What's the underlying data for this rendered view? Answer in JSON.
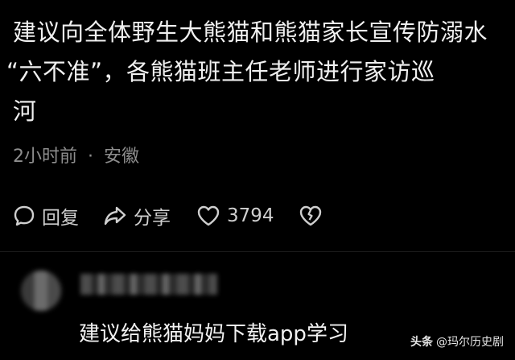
{
  "comment": {
    "lines": [
      "建议向全体野生大熊猫和熊猫家长宣传防溺水",
      "“六不准”，各熊猫班主任老师进行家访巡",
      "河"
    ],
    "time": "2小时前",
    "separator": "·",
    "location": "安徽"
  },
  "actions": {
    "reply_label": "回复",
    "share_label": "分享",
    "like_count": "3794",
    "reply_icon": "chat-bubble-icon",
    "share_icon": "share-arrow-icon",
    "like_icon": "heart-outline-icon",
    "dislike_icon": "broken-heart-icon"
  },
  "reply": {
    "text": "建议给熊猫妈妈下载app学习"
  },
  "watermark": {
    "brand": "头条",
    "handle": "@玛尔历史剧"
  },
  "colors": {
    "background": "#000000",
    "text": "#f0f0f0",
    "meta": "#8e8e8e"
  }
}
